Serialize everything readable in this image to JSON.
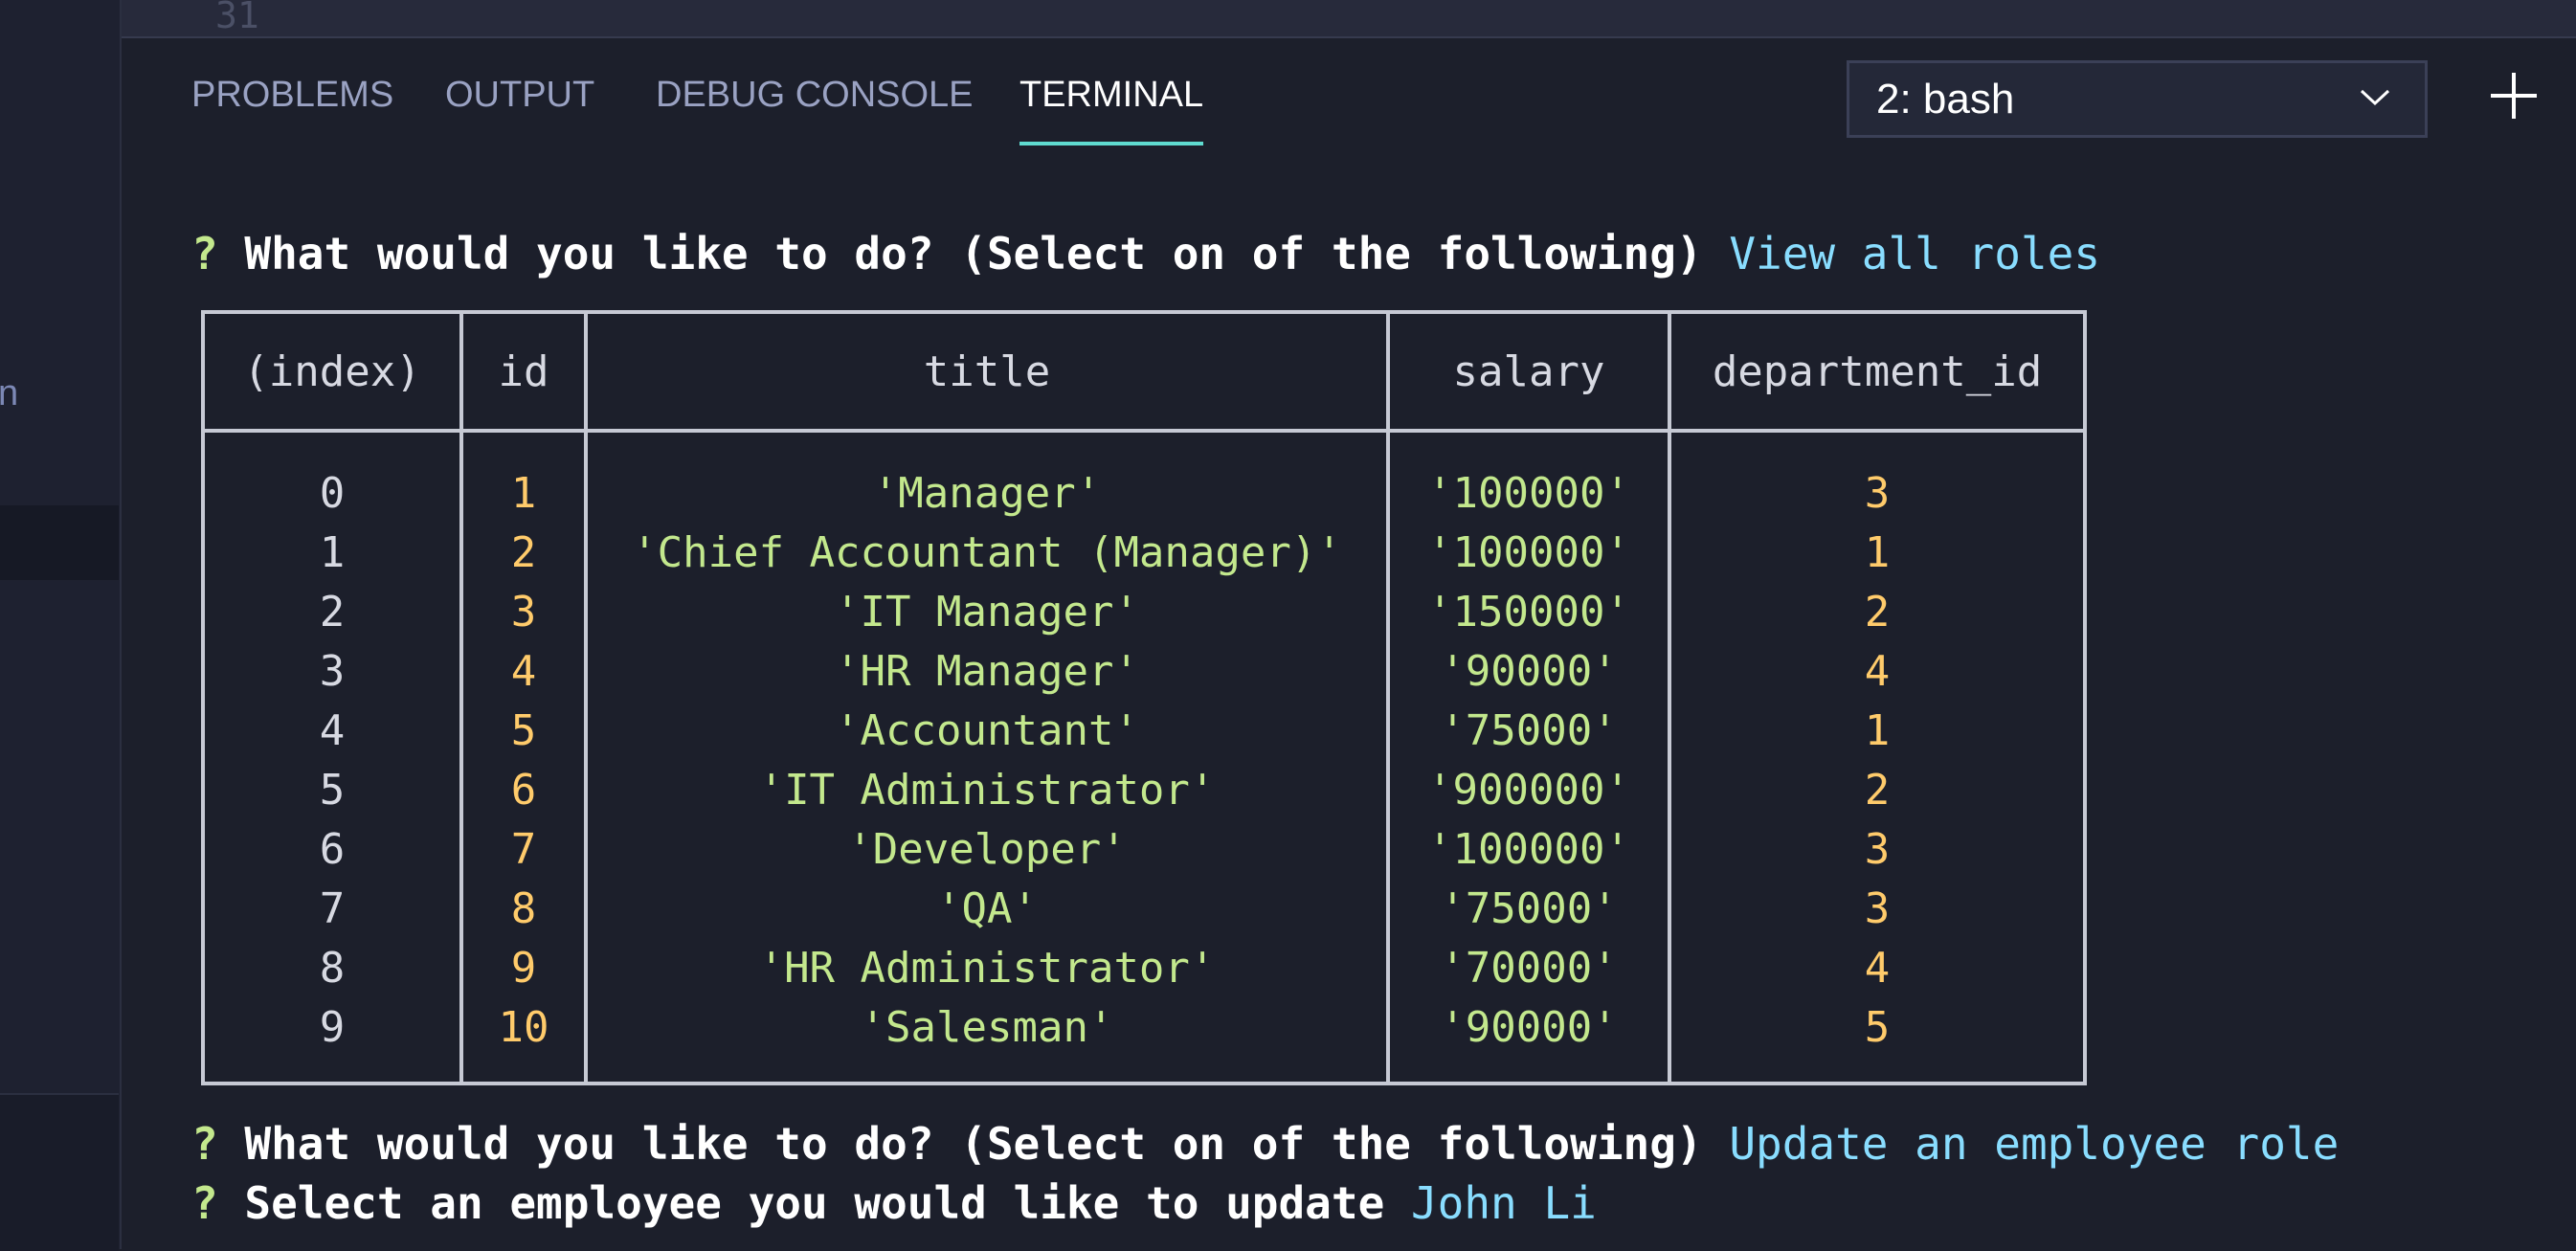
{
  "editor": {
    "line_number": "31"
  },
  "panel": {
    "tabs": [
      {
        "label": "PROBLEMS",
        "active": false
      },
      {
        "label": "OUTPUT",
        "active": false
      },
      {
        "label": "DEBUG CONSOLE",
        "active": false
      },
      {
        "label": "TERMINAL",
        "active": true
      }
    ],
    "terminal_select": {
      "value": "2: bash",
      "icon": "chevron-down-icon"
    },
    "new_terminal_icon": "plus-icon"
  },
  "terminal": {
    "prompt_symbol": "?",
    "prompt1": {
      "question": "What would you like to do? (Select on of the following)",
      "answer": "View all roles"
    },
    "table": {
      "headers": [
        "(index)",
        "id",
        "title",
        "salary",
        "department_id"
      ],
      "rows": [
        [
          "0",
          "1",
          "'Manager'",
          "'100000'",
          "3"
        ],
        [
          "1",
          "2",
          "'Chief Accountant (Manager)'",
          "'100000'",
          "1"
        ],
        [
          "2",
          "3",
          "'IT Manager'",
          "'150000'",
          "2"
        ],
        [
          "3",
          "4",
          "'HR Manager'",
          "'90000'",
          "4"
        ],
        [
          "4",
          "5",
          "'Accountant'",
          "'75000'",
          "1"
        ],
        [
          "5",
          "6",
          "'IT Administrator'",
          "'900000'",
          "2"
        ],
        [
          "6",
          "7",
          "'Developer'",
          "'100000'",
          "3"
        ],
        [
          "7",
          "8",
          "'QA'",
          "'75000'",
          "3"
        ],
        [
          "8",
          "9",
          "'HR Administrator'",
          "'70000'",
          "4"
        ],
        [
          "9",
          "10",
          "'Salesman'",
          "'90000'",
          "5"
        ]
      ]
    },
    "prompt2": {
      "question": "What would you like to do? (Select on of the following)",
      "answer": "Update an employee role"
    },
    "prompt3": {
      "question": "Select an employee you would like to update",
      "answer": "John Li"
    }
  },
  "colors": {
    "background": "#1c1f2b",
    "accent_tab_underline": "#5fdbd0",
    "prompt_symbol": "#c3e88d",
    "answer": "#89ddff",
    "number": "#ffcb6b",
    "string": "#c3e88d"
  }
}
